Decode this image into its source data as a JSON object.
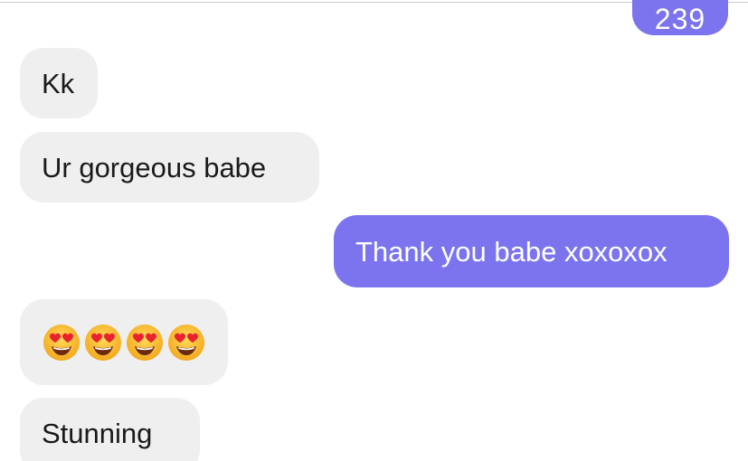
{
  "messages": [
    {
      "direction": "outgoing",
      "text": "239"
    },
    {
      "direction": "incoming",
      "text": "Kk"
    },
    {
      "direction": "incoming",
      "text": "Ur gorgeous babe"
    },
    {
      "direction": "outgoing",
      "text": "Thank you babe xoxoxox"
    },
    {
      "direction": "incoming",
      "emoji": [
        "heart-eyes-emoji",
        "heart-eyes-emoji",
        "heart-eyes-emoji",
        "heart-eyes-emoji"
      ]
    },
    {
      "direction": "incoming",
      "text": "Stunning"
    }
  ],
  "colors": {
    "outgoing_bubble": "#7b74ee",
    "incoming_bubble": "#efefef",
    "outgoing_text": "#ffffff",
    "incoming_text": "#1a1a1a"
  }
}
